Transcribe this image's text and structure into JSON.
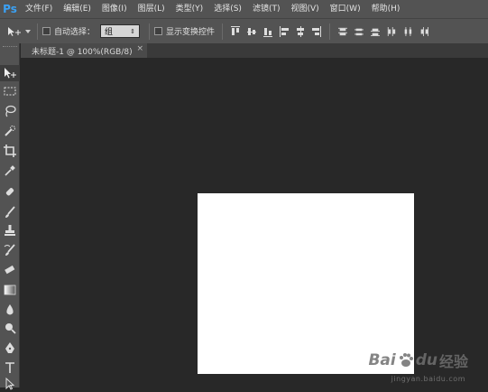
{
  "app": {
    "logo": "Ps"
  },
  "menu": {
    "items": [
      "文件(F)",
      "编辑(E)",
      "图像(I)",
      "图层(L)",
      "类型(Y)",
      "选择(S)",
      "滤镜(T)",
      "视图(V)",
      "窗口(W)",
      "帮助(H)"
    ]
  },
  "options": {
    "auto_select_label": "自动选择：",
    "auto_select_value": "组",
    "show_transform_label": "显示变换控件"
  },
  "document": {
    "tab_title": "未标题-1 @ 100%(RGB/8)",
    "close_glyph": "×"
  },
  "watermark": {
    "brand": "Bai",
    "brand2": "du",
    "cn": "经验",
    "url": "jingyan.baidu.com"
  },
  "colors": {
    "chrome": "#535353",
    "workspace": "#282828",
    "canvas": "#ffffff",
    "logo": "#3ba1f4"
  }
}
